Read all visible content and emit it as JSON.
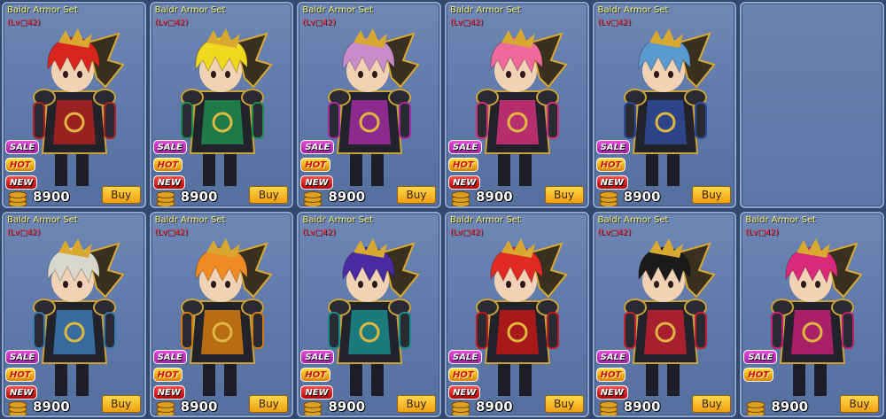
{
  "items": [
    {
      "name": "Baldr Armor Set",
      "level": "(Lv□42)",
      "price": "8900",
      "buy_label": "Buy",
      "hair": "#d8261e",
      "accent": "#b02020",
      "badges": [
        "SALE",
        "HOT",
        "NEW"
      ]
    },
    {
      "name": "Baldr Armor Set",
      "level": "(Lv□42)",
      "price": "8900",
      "buy_label": "Buy",
      "hair": "#f0d81e",
      "accent": "#1f8a4c",
      "badges": [
        "SALE",
        "HOT",
        "NEW"
      ]
    },
    {
      "name": "Baldr Armor Set",
      "level": "(Lv□42)",
      "price": "8900",
      "buy_label": "Buy",
      "hair": "#c88cc8",
      "accent": "#a02ca0",
      "badges": [
        "SALE",
        "HOT",
        "NEW"
      ]
    },
    {
      "name": "Baldr Armor Set",
      "level": "(Lv□42)",
      "price": "8900",
      "buy_label": "Buy",
      "hair": "#ee6a9a",
      "accent": "#d0307a",
      "badges": [
        "SALE",
        "HOT",
        "NEW"
      ]
    },
    {
      "name": "Baldr Armor Set",
      "level": "(Lv□42)",
      "price": "8900",
      "buy_label": "Buy",
      "hair": "#5a9ad0",
      "accent": "#304a9a",
      "badges": [
        "SALE",
        "HOT",
        "NEW"
      ]
    },
    {
      "empty": true
    },
    {
      "name": "Baldr Armor Set",
      "level": "(Lv□42)",
      "price": "8900",
      "buy_label": "Buy",
      "hair": "#d8d8d0",
      "accent": "#3a78b0",
      "badges": [
        "SALE",
        "HOT",
        "NEW"
      ]
    },
    {
      "name": "Baldr Armor Set",
      "level": "(Lv□42)",
      "price": "8900",
      "buy_label": "Buy",
      "hair": "#f08a22",
      "accent": "#d07a10",
      "badges": [
        "SALE",
        "HOT",
        "NEW"
      ]
    },
    {
      "name": "Baldr Armor Set",
      "level": "(Lv□42)",
      "price": "8900",
      "buy_label": "Buy",
      "hair": "#4a2aa0",
      "accent": "#1a8a8a",
      "badges": [
        "SALE",
        "HOT",
        "NEW"
      ]
    },
    {
      "name": "Baldr Armor Set",
      "level": "(Lv□42)",
      "price": "8900",
      "buy_label": "Buy",
      "hair": "#e02a22",
      "accent": "#c01818",
      "badges": [
        "SALE",
        "HOT",
        "NEW"
      ]
    },
    {
      "name": "Baldr Armor Set",
      "level": "(Lv□42)",
      "price": "8900",
      "buy_label": "Buy",
      "hair": "#1a1a1a",
      "accent": "#c02030",
      "badges": [
        "SALE",
        "HOT",
        "NEW"
      ]
    },
    {
      "name": "Baldr Armor Set",
      "level": "(Lv□42)",
      "price": "8900",
      "buy_label": "Buy",
      "hair": "#d82a78",
      "accent": "#c02070",
      "badges": [
        "SALE",
        "HOT"
      ]
    }
  ]
}
